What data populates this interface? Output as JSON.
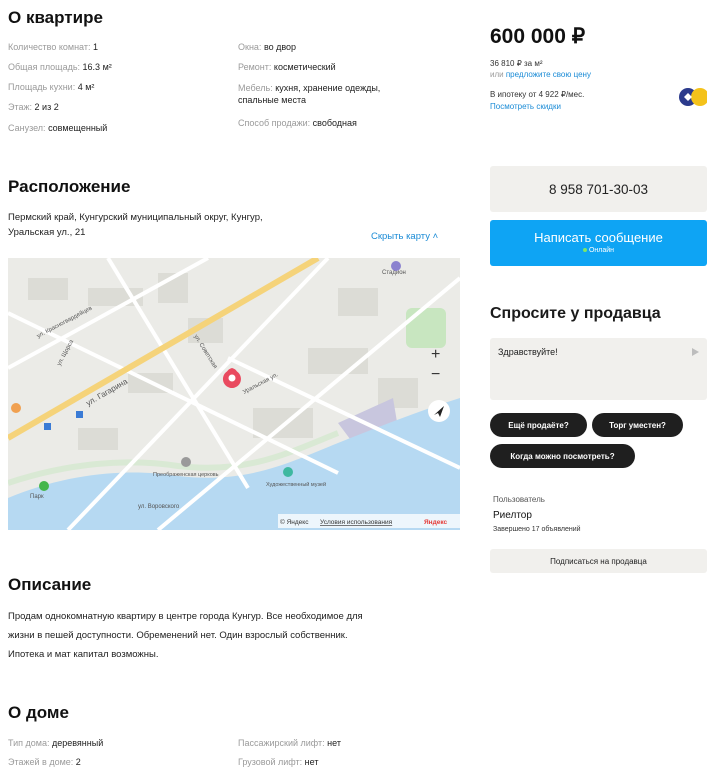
{
  "about_flat": {
    "title": "О квартире",
    "params": [
      {
        "key": "Количество комнат:",
        "value": "1"
      },
      {
        "key": "Общая площадь:",
        "value": "16.3 м²"
      },
      {
        "key": "Площадь кухни:",
        "value": "4 м²"
      },
      {
        "key": "Этаж:",
        "value": "2 из 2"
      },
      {
        "key": "Санузел:",
        "value": "совмещенный"
      },
      {
        "key": "Окна:",
        "value": "во двор"
      },
      {
        "key": "Ремонт:",
        "value": "косметический"
      },
      {
        "key": "Мебель:",
        "value": "кухня, хранение одежды,",
        "value2": "спальные места"
      },
      {
        "key": "Способ продажи:",
        "value": "свободная"
      }
    ]
  },
  "location": {
    "title": "Расположение",
    "address_line1": "Пермский край, Кунгурский муниципальный округ, Кунгур,",
    "address_line2": "Уральская ул., 21",
    "hide_map": "Скрыть карту",
    "map": {
      "labels": {
        "street_gagarina": "ул. Гагарина",
        "street_krasnogvardeytsev": "ул. Красногвардейцев",
        "street_uralskaya": "Уральская ул.",
        "street_shchorsa": "ул. Щорса",
        "street_sovetskaya": "ул. Советская",
        "street_vorovskogo": "ул. Воровского",
        "poi_stadium": "Стадион",
        "poi_park": "Парк",
        "poi_museum": "Художественный музей",
        "poi_church": "Преображенская церковь"
      },
      "zoom_in": "+",
      "zoom_out": "−",
      "copyright": "© Яндекс",
      "terms": "Условия использования",
      "brand": "Яндекс"
    }
  },
  "description": {
    "title": "Описание",
    "line1": "Продам однокомнатную квартиру в центре города Кунгур. Все необходимое для",
    "line2": "жизни в пешей доступности. Обременений нет. Один взрослый собственник.",
    "line3": "Ипотека и мат капитал возможны."
  },
  "house": {
    "title": "О доме",
    "params": [
      {
        "key": "Тип дома:",
        "value": "деревянный"
      },
      {
        "key": "Этажей в доме:",
        "value": "2"
      },
      {
        "key": "Пассажирский лифт:",
        "value": "нет"
      },
      {
        "key": "Грузовой лифт:",
        "value": "нет"
      }
    ]
  },
  "sidebar": {
    "price": "600 000 ₽",
    "price_per_m": "36 810 ₽ за м²",
    "offer_prefix": "или",
    "offer_link": "предложите свою цену",
    "mortgage": "В ипотеку от 4 922 ₽/мес.",
    "discounts_link": "Посмотреть скидки",
    "phone": "8 958 701-30-03",
    "message_button": "Написать сообщение",
    "online": "Онлайн",
    "ask_title": "Спросите у продавца",
    "chat_text": "Здравствуйте!",
    "chips": [
      "Ещё продаёте?",
      "Торг уместен?",
      "Когда можно посмотреть?"
    ],
    "seller_type": "Пользователь",
    "seller_name": "Риелтор",
    "seller_stats": "Завершено 17 объявлений",
    "subscribe": "Подписаться на продавца"
  },
  "colors": {
    "accent_blue": "#0ea4f4",
    "link_blue": "#1a8bd6",
    "map_pin": "#e94a5f",
    "road_main": "#f5d37a",
    "water": "#b6d9f2"
  }
}
